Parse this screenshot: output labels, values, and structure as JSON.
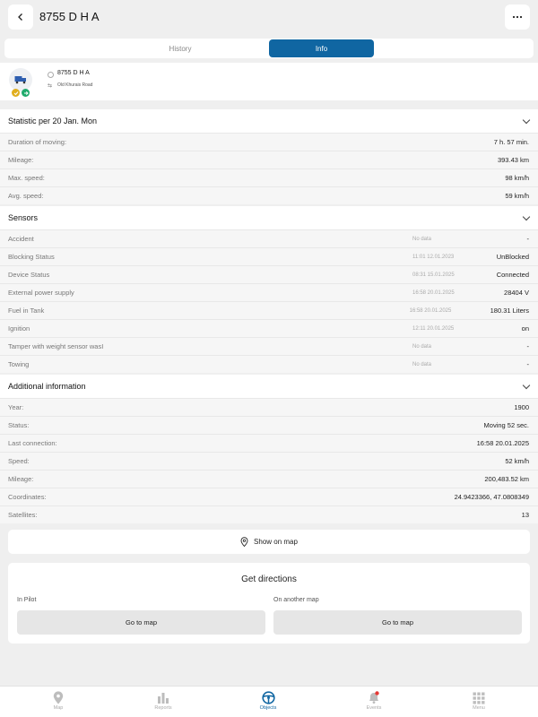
{
  "header": {
    "title": "8755 D H A"
  },
  "tabs": [
    {
      "label": "History"
    },
    {
      "label": "Info"
    }
  ],
  "vehicle": {
    "name": "8755 D H A",
    "address": "Old Khurais Road"
  },
  "statistics": {
    "title": "Statistic per 20 Jan. Mon",
    "rows": [
      {
        "label": "Duration of moving:",
        "value": "7 h. 57 min."
      },
      {
        "label": "Mileage:",
        "value": "393.43 km"
      },
      {
        "label": "Max. speed:",
        "value": "98 km/h"
      },
      {
        "label": "Avg. speed:",
        "value": "59 km/h"
      }
    ]
  },
  "sensors": {
    "title": "Sensors",
    "rows": [
      {
        "label": "Accident",
        "time": "No data",
        "value": "-"
      },
      {
        "label": "Blocking Status",
        "time": "11:01 12.01.2023",
        "value": "UnBlocked"
      },
      {
        "label": "Device Status",
        "time": "08:31 15.01.2025",
        "value": "Connected"
      },
      {
        "label": "External power supply",
        "time": "16:58 20.01.2025",
        "value": "28404 V"
      },
      {
        "label": "Fuel in Tank",
        "time": "16:58 20.01.2025",
        "value": "180.31 Liters"
      },
      {
        "label": "Ignition",
        "time": "12:11 20.01.2025",
        "value": "on"
      },
      {
        "label": "Tamper with weight sensor wasI",
        "time": "No data",
        "value": "-"
      },
      {
        "label": "Towing",
        "time": "No data",
        "value": "-"
      }
    ]
  },
  "additional": {
    "title": "Additional information",
    "rows": [
      {
        "label": "Year:",
        "value": "1900"
      },
      {
        "label": "Status:",
        "value": "Moving 52 sec."
      },
      {
        "label": "Last connection:",
        "value": "16:58 20.01.2025"
      },
      {
        "label": "Speed:",
        "value": "52 km/h"
      },
      {
        "label": "Mileage:",
        "value": "200,483.52 km"
      },
      {
        "label": "Coordinates:",
        "value": "24.9423366, 47.0808349"
      },
      {
        "label": "Satellites:",
        "value": "13"
      }
    ]
  },
  "show_map": {
    "label": "Show on map"
  },
  "directions": {
    "title": "Get directions",
    "in_pilot_label": "In Pilot",
    "other_map_label": "On another map",
    "go_to_map": "Go to map"
  },
  "bottom_nav": [
    {
      "label": "Map",
      "icon": "map-pin-icon"
    },
    {
      "label": "Reports",
      "icon": "bar-chart-icon"
    },
    {
      "label": "Objects",
      "icon": "steering-wheel-icon"
    },
    {
      "label": "Events",
      "icon": "bell-icon"
    },
    {
      "label": "Menu",
      "icon": "grid-icon"
    }
  ],
  "colors": {
    "accent": "#1066a2",
    "badge_yellow": "#e0ae1d",
    "badge_green": "#1fab6c",
    "notification": "#e53935"
  }
}
